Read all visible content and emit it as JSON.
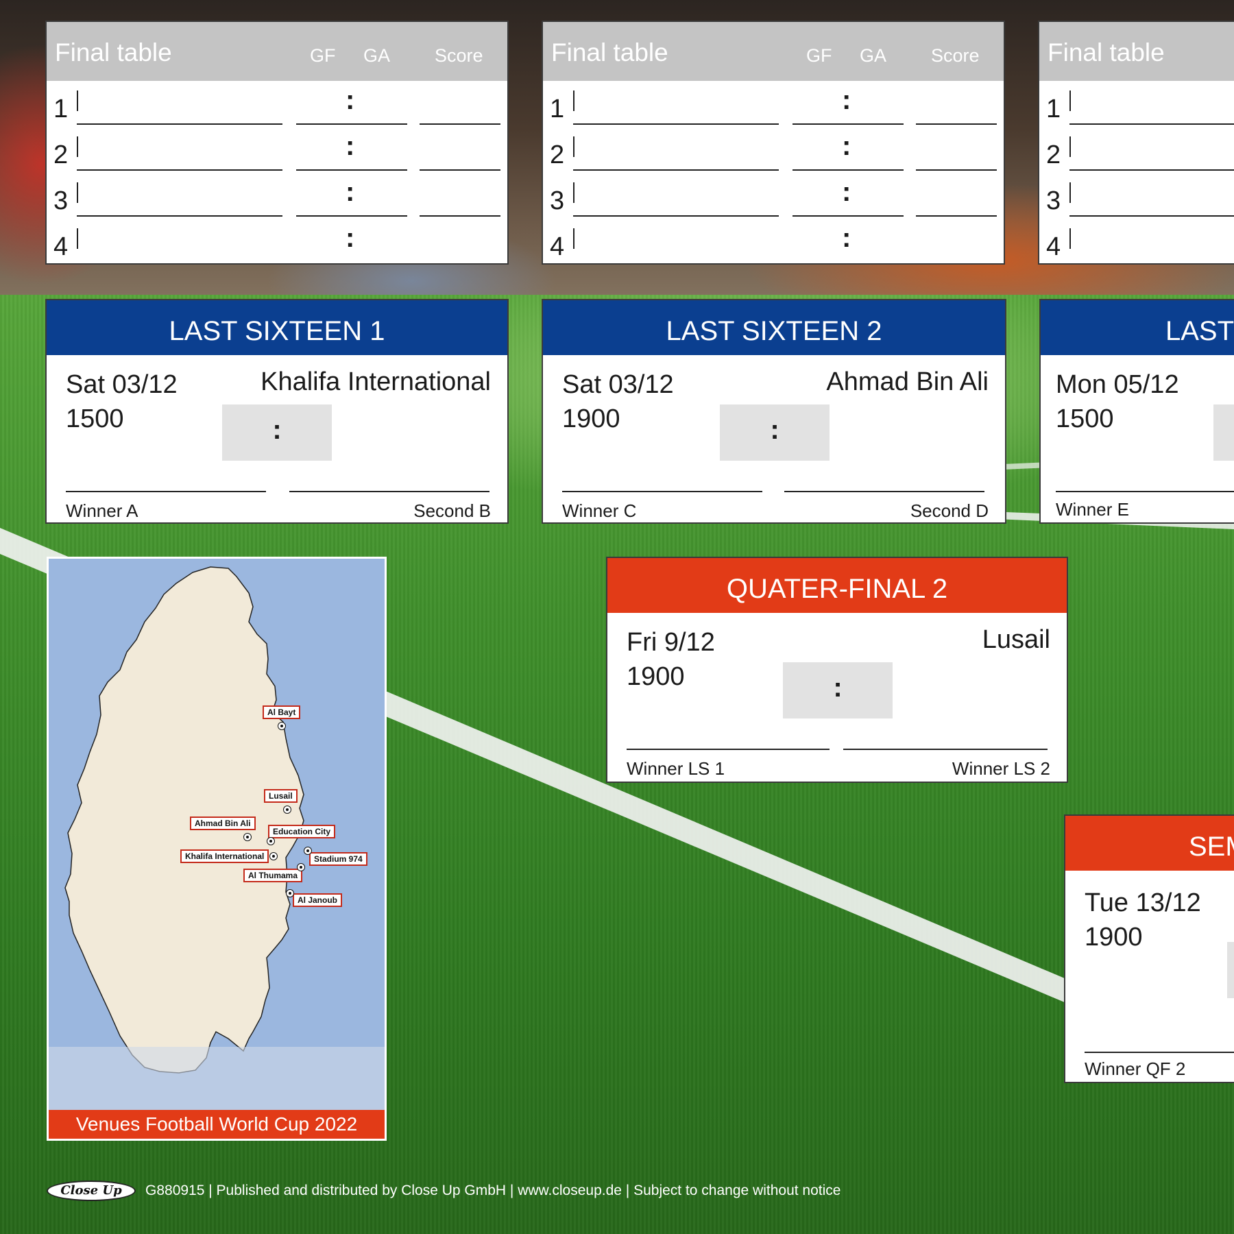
{
  "final_tables": [
    {
      "title": "Final table",
      "gf": "GF",
      "ga": "GA",
      "score": "Score",
      "rows": [
        "1",
        "2",
        "3",
        "4"
      ],
      "colon": ":"
    },
    {
      "title": "Final table",
      "gf": "GF",
      "ga": "GA",
      "score": "Score",
      "rows": [
        "1",
        "2",
        "3",
        "4"
      ],
      "colon": ":"
    },
    {
      "title": "Final table",
      "rows": [
        "1",
        "2",
        "3",
        "4"
      ]
    }
  ],
  "last_sixteen": [
    {
      "title": "LAST SIXTEEN 1",
      "date": "Sat 03/12",
      "time": "1500",
      "venue": "Khalifa International",
      "score_sep": ":",
      "left_label": "Winner A",
      "right_label": "Second B"
    },
    {
      "title": "LAST SIXTEEN 2",
      "date": "Sat 03/12",
      "time": "1900",
      "venue": "Ahmad Bin Ali",
      "score_sep": ":",
      "left_label": "Winner C",
      "right_label": "Second D"
    },
    {
      "title": "LAST",
      "date": "Mon 05/12",
      "time": "1500",
      "left_label": "Winner E"
    }
  ],
  "quarter_final": {
    "title": "QUATER-FINAL 2",
    "date": "Fri 9/12",
    "time": "1900",
    "venue": "Lusail",
    "score_sep": ":",
    "left_label": "Winner LS 1",
    "right_label": "Winner LS 2"
  },
  "semi_final": {
    "title": "SEM",
    "date": "Tue 13/12",
    "time": "1900",
    "left_label": "Winner QF 2"
  },
  "map": {
    "caption": "Venues Football World Cup 2022",
    "venues": [
      "Al Bayt",
      "Lusail",
      "Ahmad Bin Ali",
      "Education City",
      "Khalifa International",
      "Stadium 974",
      "Al Thumama",
      "Al Janoub"
    ],
    "colors": {
      "sea": "#9bb7df",
      "land": "#f2ead9",
      "label_border": "#c42a1a"
    }
  },
  "footer": {
    "logo": "Close Up",
    "text": "G880915 | Published and distributed by Close Up GmbH | www.closeup.de | Subject to change without notice"
  },
  "colors": {
    "blue_header": "#0b3f90",
    "red_header": "#e23b17",
    "table_header": "#c4c4c4",
    "score_box": "#e2e2e2"
  }
}
